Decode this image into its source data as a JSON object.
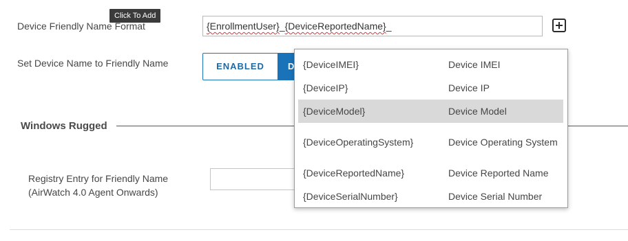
{
  "tooltip": {
    "text": "Click To Add"
  },
  "friendly_name": {
    "label": "Device Friendly Name Format",
    "value_part1": "{EnrollmentUser}",
    "value_sep": "_",
    "value_part2": "{DeviceReportedName}",
    "value_tail": "_"
  },
  "device_name": {
    "label": "Set Device Name to Friendly Name",
    "enabled_label": "ENABLED",
    "disabled_label": "D"
  },
  "windows_rugged": {
    "title": "Windows Rugged",
    "registry_label_line1": "Registry Entry for Friendly Name",
    "registry_label_line2": "(AirWatch 4.0 Agent Onwards)"
  },
  "dropdown": {
    "items": [
      {
        "token": "{DeviceIMEI}",
        "description": "Device IMEI",
        "selected": false
      },
      {
        "token": "{DeviceIP}",
        "description": "Device IP",
        "selected": false
      },
      {
        "token": "{DeviceModel}",
        "description": "Device Model",
        "selected": true
      },
      {
        "token": "{DeviceOperatingSystem}",
        "description": "Device Operating System",
        "selected": false
      },
      {
        "token": "{DeviceReportedName}",
        "description": "Device Reported Name",
        "selected": false
      },
      {
        "token": "{DeviceSerialNumber}",
        "description": "Device Serial Number",
        "selected": false
      }
    ]
  },
  "colors": {
    "accent": "#1a73b8",
    "tooltip_bg": "#3b3b3b",
    "selected_row": "#d9d9d9"
  },
  "icons": {
    "add": "plus-square-icon"
  }
}
